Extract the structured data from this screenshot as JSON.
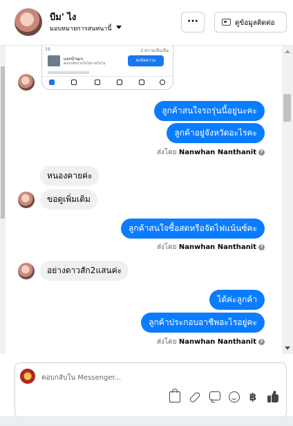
{
  "header": {
    "contact_name": "บีม' ไง",
    "assign_label": "มอบหมายการสนทนานี้",
    "more_label": "···",
    "contact_info_label": "ดูข้อมูลติดต่อ"
  },
  "shared_image": {
    "top_left": "19",
    "top_right": "2 ความเห็นเห็น",
    "listing_title": "แจกบ้านเก",
    "listing_sub": "ตอบกลับภายในไม่ภายในวัน",
    "button": "ส่งข้อความ"
  },
  "messages": [
    {
      "direction": "out",
      "text": "ลูกค้าสนใจรถรุ่นนี้อยู่นะคะ"
    },
    {
      "direction": "out",
      "text": "ลูกค้าอยู่จังหวัดอะไรคะ"
    },
    {
      "direction": "in",
      "text": "หนองคายค่ะ"
    },
    {
      "direction": "in",
      "text": "ขอดูเพิ่มเติม"
    },
    {
      "direction": "out",
      "text": "ลูกค้าสนใจซื้อสดหรือจัดไฟแน้นซ์คะ"
    },
    {
      "direction": "in",
      "text": "อย่างดาวสัก2แสนค่ะ"
    },
    {
      "direction": "out",
      "text": "ได้ค่ะลูกค้า"
    },
    {
      "direction": "out",
      "text": "ลูกค้าประกอบอาชีพอะไรอยู่คะ"
    }
  ],
  "sent_by": {
    "prefix": "ส่งโดย",
    "agent": "Nanwhan Nanthanit",
    "info_icon": "info-icon"
  },
  "composer": {
    "placeholder": "ตอบกลับใน Messenger..."
  },
  "icons": {
    "baht_symbol": "฿"
  },
  "colors": {
    "outgoing_bubble": "#0a7cff",
    "incoming_bubble": "#f0f0f0",
    "accent": "#1877f2"
  }
}
